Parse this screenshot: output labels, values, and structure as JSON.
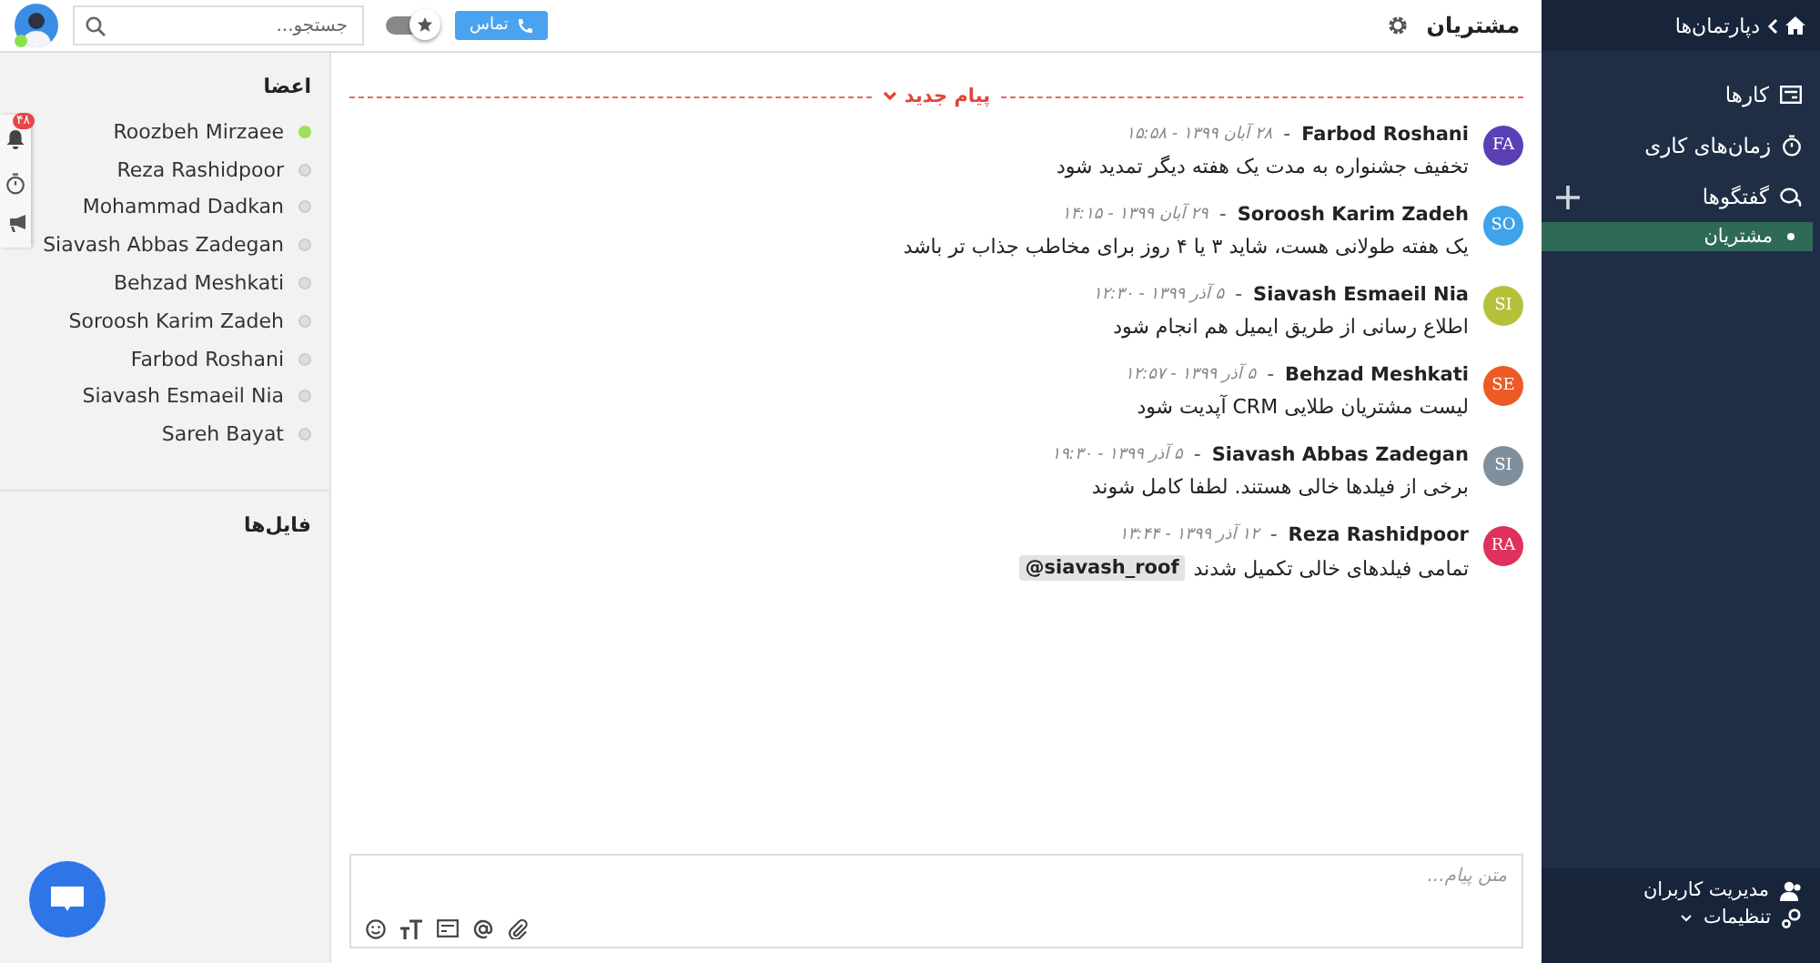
{
  "sidebar": {
    "breadcrumb": "دپارتمان‌ها",
    "items": [
      {
        "label": "کارها"
      },
      {
        "label": "زمان‌های کاری"
      },
      {
        "label": "گفتگوها",
        "children": [
          {
            "label": "مشتریان",
            "selected": true
          }
        ]
      }
    ],
    "footer": [
      {
        "label": "مدیریت کاربران"
      },
      {
        "label": "تنظیمات",
        "expandable": true
      }
    ]
  },
  "header": {
    "title": "مشتریان",
    "call_button": "تماس",
    "favorite_toggle": {
      "on": true
    },
    "search": {
      "placeholder": "جستجو..."
    },
    "user": {
      "online": true
    }
  },
  "chat": {
    "new_messages_divider": "پیام جدید",
    "messages": [
      {
        "initials": "FA",
        "color": "#5b3fb5",
        "author": "Farbod Roshani",
        "separator": "-",
        "date": "۲۸ آبان ۱۳۹۹ - ۱۵:۵۸",
        "text": "تخفیف جشنواره به مدت یک هفته دیگر تمدید شود"
      },
      {
        "initials": "SO",
        "color": "#3ea3e8",
        "author": "Soroosh Karim Zadeh",
        "separator": "-",
        "date": "۲۹ آبان ۱۳۹۹ - ۱۴:۱۵",
        "text": "یک هفته طولانی هست، شاید ۳ یا ۴ روز برای مخاطب جذاب تر باشد"
      },
      {
        "initials": "SI",
        "color": "#b5c13a",
        "author": "Siavash Esmaeil Nia",
        "separator": "-",
        "date": "۵ آذر ۱۳۹۹ - ۱۲:۳۰",
        "text": "اطلاع رسانی از طریق ایمیل هم انجام شود"
      },
      {
        "initials": "SE",
        "color": "#ec5a25",
        "author": "Behzad Meshkati",
        "separator": "-",
        "date": "۵ آذر ۱۳۹۹ - ۱۲:۵۷",
        "text": "لیست مشتریان طلایی CRM آپدیت شود"
      },
      {
        "initials": "SI",
        "color": "#7f909c",
        "author": "Siavash Abbas Zadegan",
        "separator": "-",
        "date": "۵ آذر ۱۳۹۹ - ۱۹:۳۰",
        "text": "برخی از فیلدها خالی هستند. لطفا کامل شوند"
      },
      {
        "initials": "RA",
        "color": "#e0305c",
        "author": "Reza Rashidpoor",
        "separator": "-",
        "date": "۱۲ آذر ۱۳۹۹ - ۱۳:۴۴",
        "text": "تمامی فیلدهای خالی تکمیل شدند",
        "mention": "@siavash_roof"
      }
    ],
    "composer": {
      "placeholder": "متن پیام..."
    }
  },
  "members": {
    "title": "اعضا",
    "list": [
      {
        "name": "Roozbeh Mirzaee",
        "online": true
      },
      {
        "name": "Reza Rashidpoor",
        "online": false
      },
      {
        "name": "Mohammad Dadkan",
        "online": false
      },
      {
        "name": "Siavash Abbas Zadegan",
        "online": false
      },
      {
        "name": "Behzad Meshkati",
        "online": false
      },
      {
        "name": "Soroosh Karim Zadeh",
        "online": false
      },
      {
        "name": "Farbod Roshani",
        "online": false
      },
      {
        "name": "Siavash Esmaeil Nia",
        "online": false
      },
      {
        "name": "Sareh Bayat",
        "online": false
      }
    ],
    "files_title": "فایل‌ها"
  },
  "quick_bar": {
    "notification_count": "۴۸"
  }
}
